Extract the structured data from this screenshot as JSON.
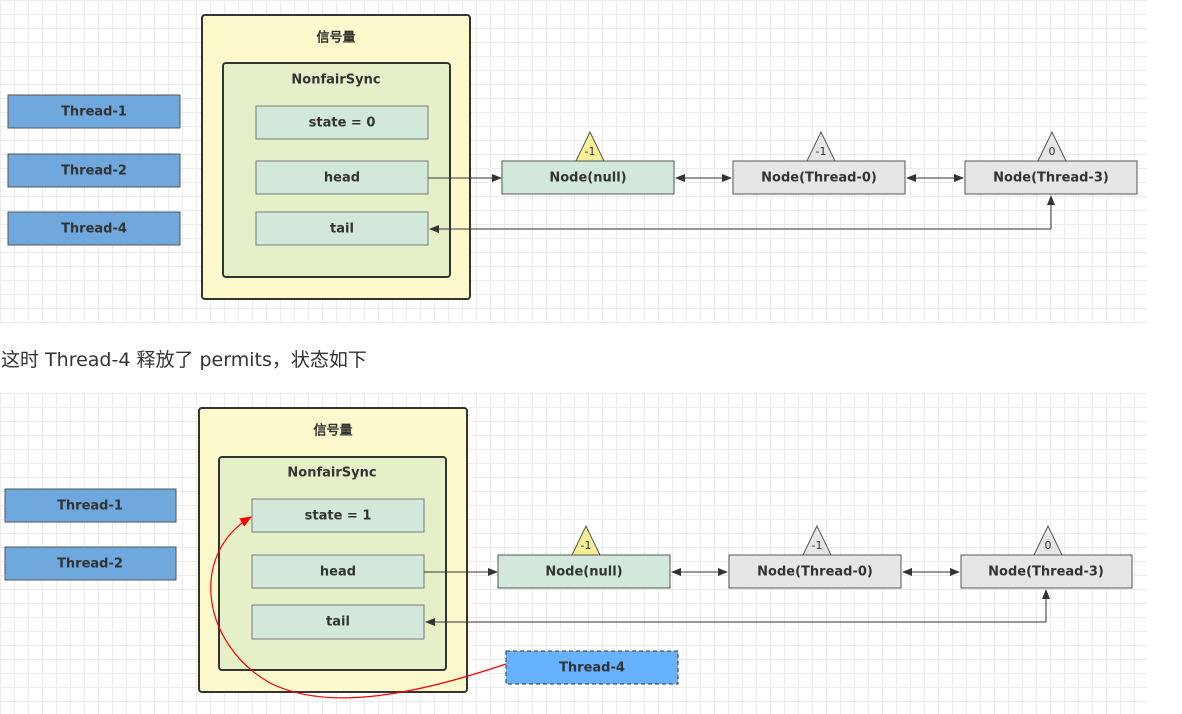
{
  "diagram1": {
    "semaphore_label": "信号量",
    "sync_label": "NonfairSync",
    "state": "state = 0",
    "head": "head",
    "tail": "tail",
    "threads": [
      "Thread-1",
      "Thread-2",
      "Thread-4"
    ],
    "nodes": [
      {
        "label": "Node(null)",
        "waitStatus": "-1"
      },
      {
        "label": "Node(Thread-0)",
        "waitStatus": "-1"
      },
      {
        "label": "Node(Thread-3)",
        "waitStatus": "0"
      }
    ]
  },
  "caption": "这时 Thread-4 释放了 permits，状态如下",
  "diagram2": {
    "semaphore_label": "信号量",
    "sync_label": "NonfairSync",
    "state": "state = 1",
    "head": "head",
    "tail": "tail",
    "threads": [
      "Thread-1",
      "Thread-2"
    ],
    "releasing_thread": "Thread-4",
    "nodes": [
      {
        "label": "Node(null)",
        "waitStatus": "-1"
      },
      {
        "label": "Node(Thread-0)",
        "waitStatus": "-1"
      },
      {
        "label": "Node(Thread-3)",
        "waitStatus": "0"
      }
    ]
  },
  "colors": {
    "semaphore_box": "#fcf9cc",
    "sync_box": "#e6f0c8",
    "field_box": "#d2e8da",
    "thread_box": "#6fa8dc",
    "thread_releasing": "#66b2ff",
    "node_head": "#d2e8da",
    "node_other": "#e6e6e6",
    "status_yellow": "#f7ef95",
    "status_gray": "#e6e6e6",
    "release_arrow": "#ff0000"
  }
}
